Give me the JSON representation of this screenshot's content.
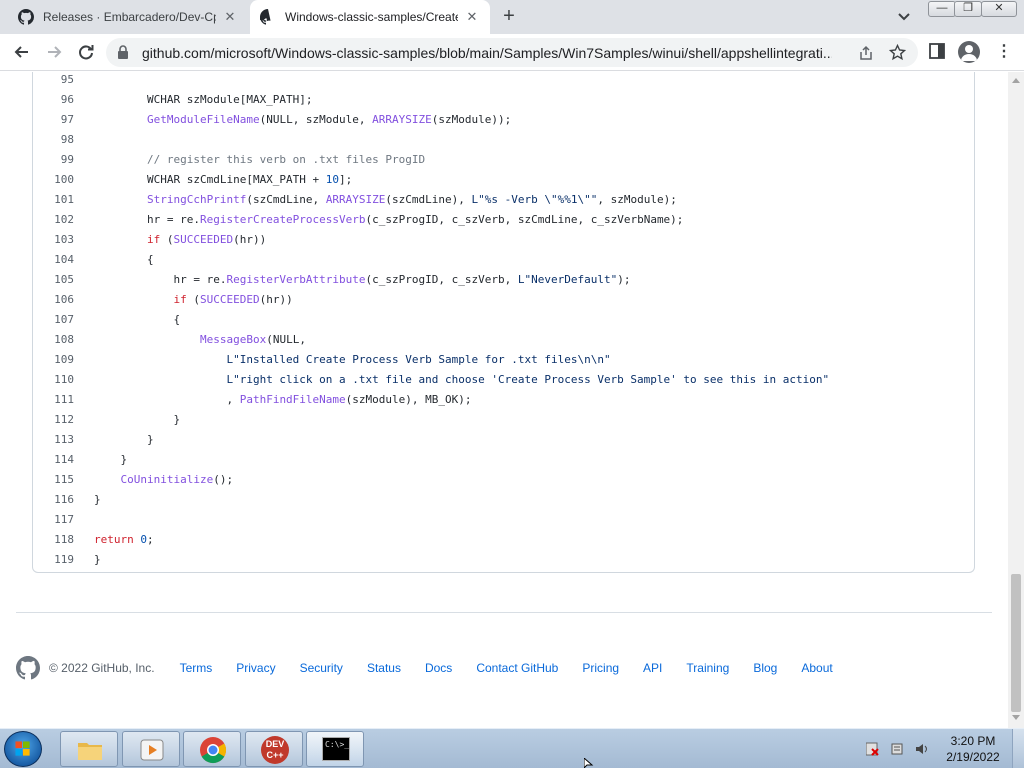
{
  "tabs": [
    {
      "title": "Releases · Embarcadero/Dev-Cpp",
      "active": false
    },
    {
      "title": "Windows-classic-samples/Create",
      "active": true
    }
  ],
  "toolbar": {
    "url": "github.com/microsoft/Windows-classic-samples/blob/main/Samples/Win7Samples/winui/shell/appshellintegrati..."
  },
  "code_lines": [
    {
      "n": "95",
      "html": ""
    },
    {
      "n": "96",
      "html": "        WCHAR szModule[MAX_PATH];"
    },
    {
      "n": "97",
      "html": "        <span class=\"fn\">GetModuleFileName</span>(NULL, szModule, <span class=\"fn\">ARRAYSIZE</span>(szModule));"
    },
    {
      "n": "98",
      "html": ""
    },
    {
      "n": "99",
      "html": "        <span class=\"cm\">// register this verb on .txt files ProgID</span>"
    },
    {
      "n": "100",
      "html": "        WCHAR szCmdLine[MAX_PATH + <span class=\"num\">10</span>];"
    },
    {
      "n": "101",
      "html": "        <span class=\"fn\">StringCchPrintf</span>(szCmdLine, <span class=\"fn\">ARRAYSIZE</span>(szCmdLine), <span class=\"str\">L\"%s -Verb \\\"%%1\\\"\"</span>, szModule);"
    },
    {
      "n": "102",
      "html": "        hr = re.<span class=\"fn\">RegisterCreateProcessVerb</span>(c_szProgID, c_szVerb, szCmdLine, c_szVerbName);"
    },
    {
      "n": "103",
      "html": "        <span class=\"kw\">if</span> (<span class=\"fn\">SUCCEEDED</span>(hr))"
    },
    {
      "n": "104",
      "html": "        {"
    },
    {
      "n": "105",
      "html": "            hr = re.<span class=\"fn\">RegisterVerbAttribute</span>(c_szProgID, c_szVerb, <span class=\"str\">L\"NeverDefault\"</span>);"
    },
    {
      "n": "106",
      "html": "            <span class=\"kw\">if</span> (<span class=\"fn\">SUCCEEDED</span>(hr))"
    },
    {
      "n": "107",
      "html": "            {"
    },
    {
      "n": "108",
      "html": "                <span class=\"fn\">MessageBox</span>(NULL,"
    },
    {
      "n": "109",
      "html": "                    <span class=\"str\">L\"Installed Create Process Verb Sample for .txt files\\n\\n\"</span>"
    },
    {
      "n": "110",
      "html": "                    <span class=\"str\">L\"right click on a .txt file and choose 'Create Process Verb Sample' to see this in action\"</span>"
    },
    {
      "n": "111",
      "html": "                    , <span class=\"fn\">PathFindFileName</span>(szModule), MB_OK);"
    },
    {
      "n": "112",
      "html": "            }"
    },
    {
      "n": "113",
      "html": "        }"
    },
    {
      "n": "114",
      "html": "    }"
    },
    {
      "n": "115",
      "html": "    <span class=\"fn\">CoUninitialize</span>();"
    },
    {
      "n": "116",
      "html": "}"
    },
    {
      "n": "117",
      "html": ""
    },
    {
      "n": "118",
      "html": "<span class=\"kw\">return</span> <span class=\"num\">0</span>;"
    },
    {
      "n": "119",
      "html": "}"
    }
  ],
  "footer": {
    "copyright": "© 2022 GitHub, Inc.",
    "links": [
      "Terms",
      "Privacy",
      "Security",
      "Status",
      "Docs",
      "Contact GitHub",
      "Pricing",
      "API",
      "Training",
      "Blog",
      "About"
    ]
  },
  "taskbar": {
    "devcpp_label": "DEV C++",
    "cmd_label": "C:\\>_",
    "time": "3:20 PM",
    "date": "2/19/2022"
  },
  "colors": {
    "link": "#0969da",
    "function": "#8250df",
    "keyword": "#cf222e",
    "comment": "#6e7781",
    "string": "#0a3069",
    "number": "#0550ae"
  }
}
